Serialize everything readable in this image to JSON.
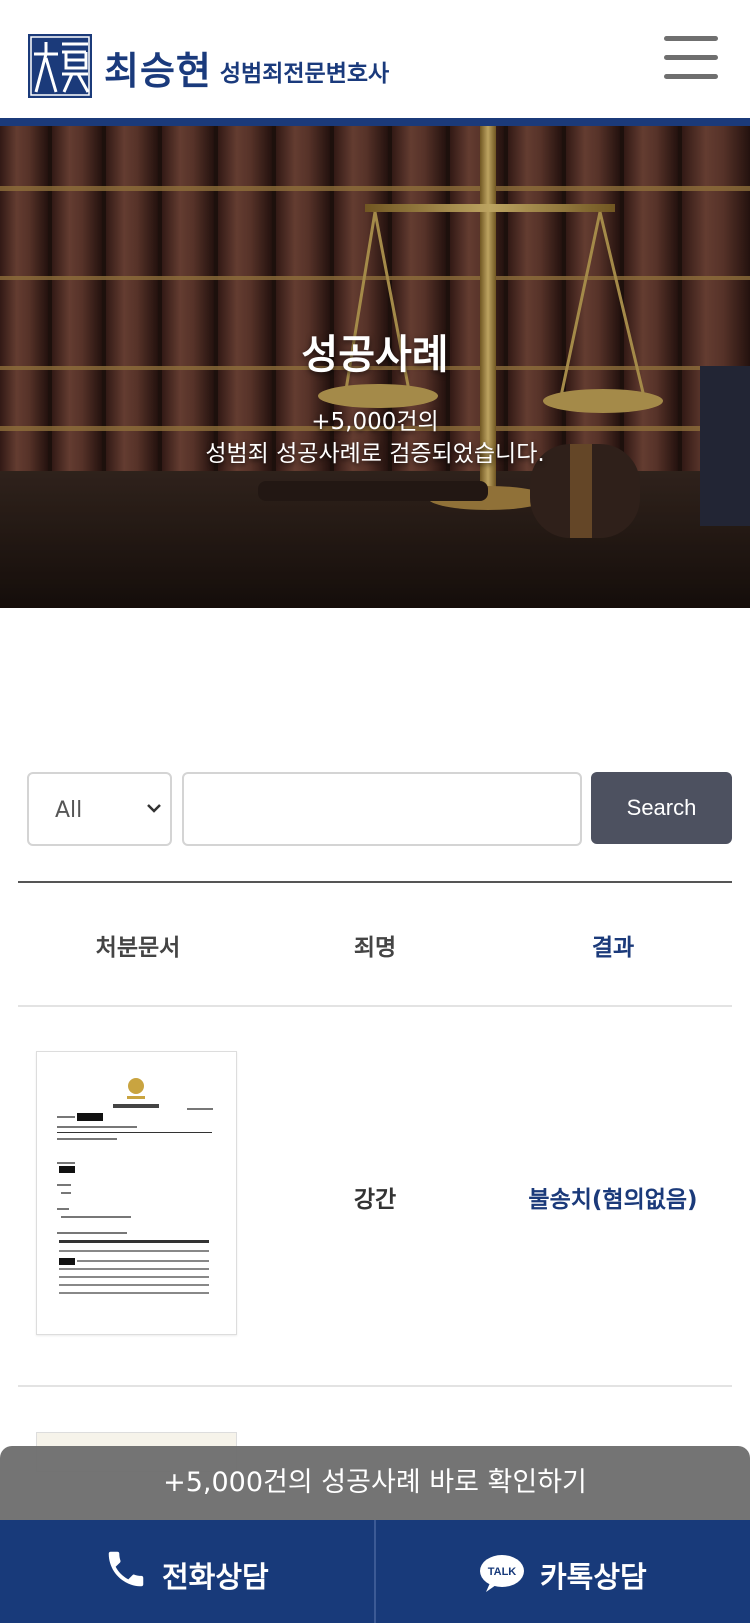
{
  "header": {
    "logo_mark_text": "大夏",
    "logo_name": "최승현",
    "logo_sub": "성범죄전문변호사",
    "menu_icon": "hamburger-menu-icon",
    "brand_color": "#1b3a7a"
  },
  "hero": {
    "title": "성공사례",
    "subtitle_line1": "+5,000건의",
    "subtitle_line2": "성범죄 성공사례로 검증되었습니다."
  },
  "search": {
    "select_value": "All",
    "input_value": "",
    "button_label": "Search"
  },
  "table": {
    "headers": [
      "처분문서",
      "죄명",
      "결과"
    ],
    "rows": [
      {
        "document_icon": "document-thumbnail",
        "crime": "강간",
        "result": "불송치(혐의없음)"
      }
    ]
  },
  "promo": {
    "label": "+5,000건의 성공사례 바로 확인하기"
  },
  "cta": {
    "phone_label": "전화상담",
    "kakao_label": "카톡상담",
    "kakao_icon_text": "TALK"
  }
}
